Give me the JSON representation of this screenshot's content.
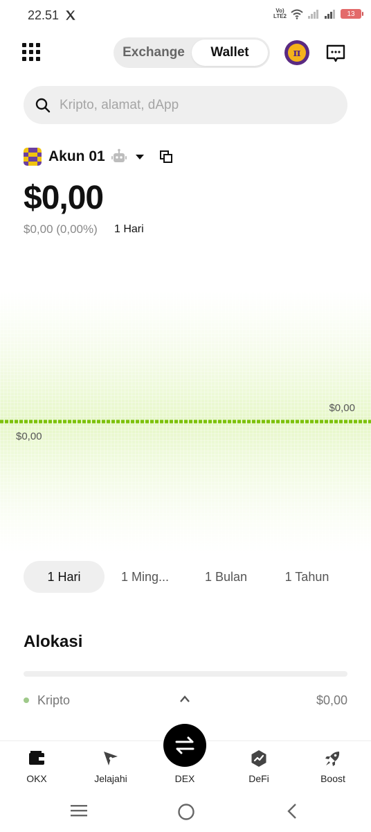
{
  "status_bar": {
    "time": "22.51",
    "volte_line1": "Vo)",
    "volte_line2": "LTE2",
    "battery": "13"
  },
  "header": {
    "menu_icon": "grid-menu-icon",
    "tabs": [
      {
        "label": "Exchange",
        "active": false
      },
      {
        "label": "Wallet",
        "active": true
      }
    ],
    "avatar_icon": "pi-network-icon",
    "avatar_text": "π",
    "chat_icon": "message-icon"
  },
  "search": {
    "placeholder": "Kripto, alamat, dApp"
  },
  "account": {
    "name": "Akun 01",
    "balance": "$0,00",
    "change": "$0,00 (0,00%)",
    "change_period": "1 Hari"
  },
  "chart_data": {
    "type": "line",
    "x": [
      0,
      1
    ],
    "series": [
      {
        "values": [
          0,
          0
        ]
      }
    ],
    "labels": {
      "right": "$0,00",
      "left": "$0,00"
    },
    "line_color": "#7cc10a"
  },
  "ranges": [
    {
      "label": "1 Hari",
      "active": true
    },
    {
      "label": "1 Ming...",
      "active": false
    },
    {
      "label": "1 Bulan",
      "active": false
    },
    {
      "label": "1 Tahun",
      "active": false
    }
  ],
  "allocation": {
    "title": "Alokasi",
    "items": [
      {
        "label": "Kripto",
        "value": "$0,00",
        "color": "#9fc98a"
      }
    ]
  },
  "bottom_nav": {
    "items": [
      {
        "label": "OKX",
        "icon": "wallet-icon"
      },
      {
        "label": "Jelajahi",
        "icon": "compass-icon"
      },
      {
        "label": "DEX",
        "icon": "swap-icon"
      },
      {
        "label": "DeFi",
        "icon": "defi-icon"
      },
      {
        "label": "Boost",
        "icon": "rocket-icon"
      }
    ]
  }
}
